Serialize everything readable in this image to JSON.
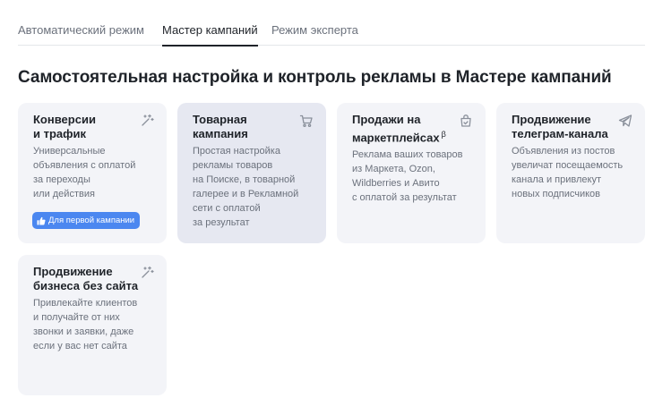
{
  "tabs": [
    {
      "label": "Автоматический режим",
      "active": false
    },
    {
      "label": "Мастер кампаний",
      "active": true
    },
    {
      "label": "Режим эксперта",
      "active": false
    }
  ],
  "page_title": "Самостоятельная настройка и контроль рекламы в Мастере кампаний",
  "cards": [
    {
      "title_lines": [
        "Конверсии",
        "и трафик"
      ],
      "title_sup": "",
      "desc_lines": [
        "Универсальные",
        "объявления с оплатой",
        "за переходы",
        "или действия"
      ],
      "icon": "magic-wand-icon",
      "badge": "Для первой кампании",
      "badge_icon": "thumbs-up-icon"
    },
    {
      "title_lines": [
        "Товарная",
        "кампания"
      ],
      "title_sup": "",
      "desc_lines": [
        "Простая настройка",
        "рекламы товаров",
        "на Поиске, в товарной",
        "галерее и в Рекламной",
        "сети с оплатой",
        "за результат"
      ],
      "icon": "cart-icon",
      "selected": true
    },
    {
      "title_lines": [
        "Продажи на",
        "маркетплейсах"
      ],
      "title_sup": "β",
      "desc_lines": [
        "Реклама ваших товаров",
        "из Маркета, Ozon,",
        "Wildberries и Авито",
        "с оплатой за результат"
      ],
      "icon": "shopping-bag-icon"
    },
    {
      "title_lines": [
        "Продвижение",
        "телеграм-канала"
      ],
      "title_sup": "",
      "desc_lines": [
        "Объявления из постов",
        "увеличат посещаемость",
        "канала и привлекут",
        "новых подписчиков"
      ],
      "icon": "telegram-plane-icon"
    },
    {
      "title_lines": [
        "Продвижение",
        "бизнеса без сайта"
      ],
      "title_sup": "",
      "desc_lines": [
        "Привлекайте клиентов",
        "и получайте от них",
        "звонки и заявки, даже",
        "если у вас нет сайта"
      ],
      "icon": "magic-wand-icon"
    }
  ],
  "colors": {
    "accent": "#4b87f0",
    "card_bg": "#f3f4f8",
    "card_selected_bg": "#e6e8f1",
    "text_primary": "#1f2329",
    "text_secondary": "#6b717c"
  }
}
